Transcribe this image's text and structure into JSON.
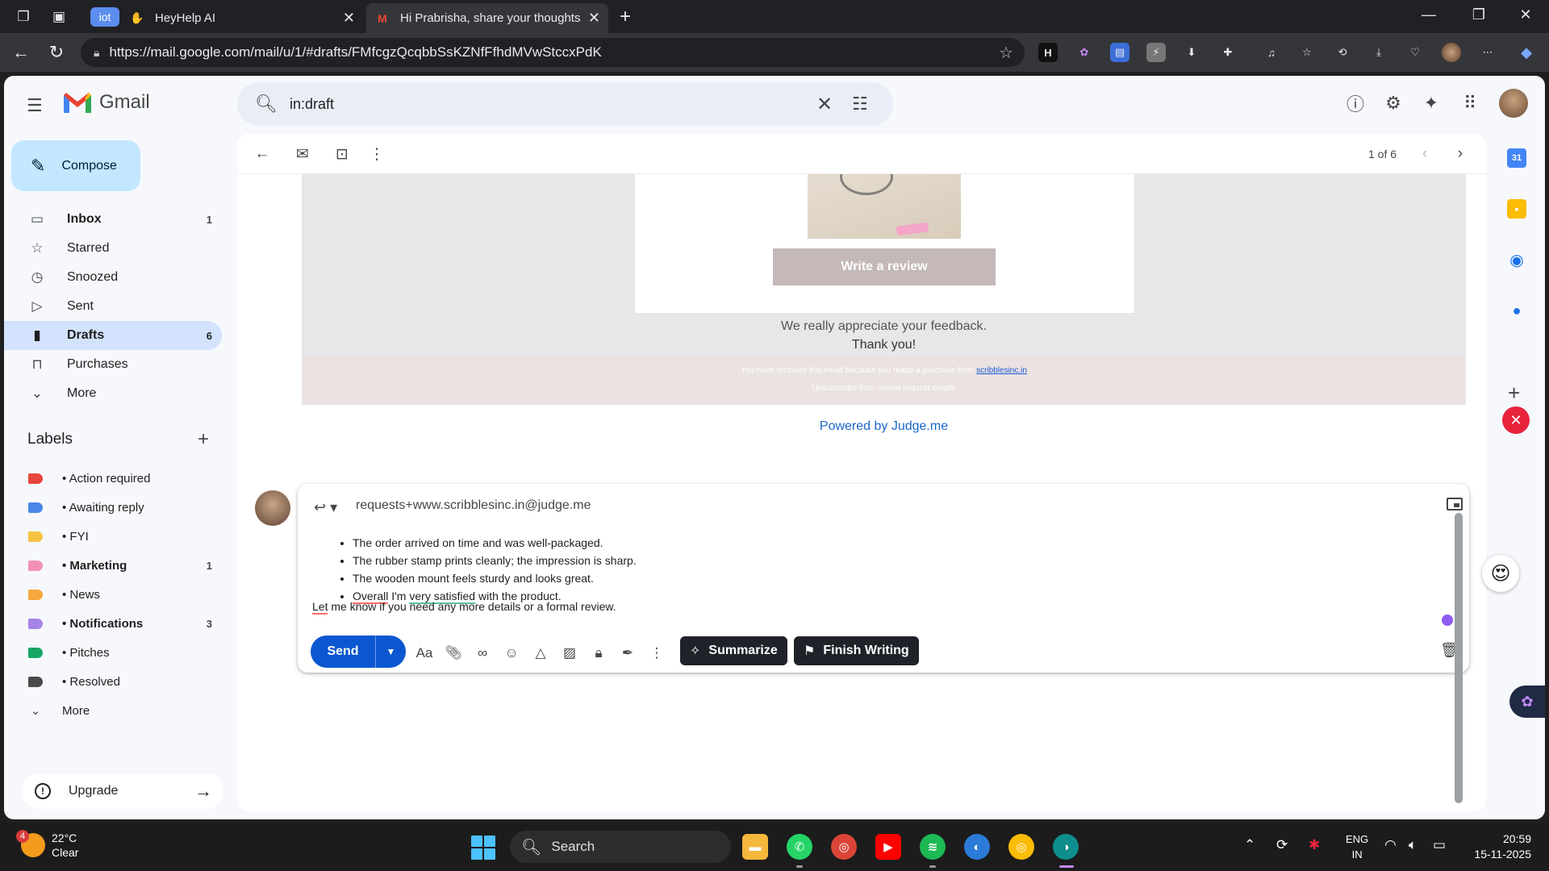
{
  "browser": {
    "tabs": [
      {
        "badge": "iot",
        "title": "HeyHelp AI"
      },
      {
        "title": "Hi Prabrisha, share your thoughts"
      }
    ],
    "url": "https://mail.google.com/mail/u/1/#drafts/FMfcgzQcqbbSsKZNfFfhdMVwStccxPdK"
  },
  "gmail": {
    "logo_text": "Gmail",
    "search_value": "in:draft",
    "compose_label": "Compose",
    "nav": [
      {
        "label": "Inbox",
        "count": "1",
        "icon": "inbox-icon"
      },
      {
        "label": "Starred",
        "count": "",
        "icon": "star-icon"
      },
      {
        "label": "Snoozed",
        "count": "",
        "icon": "clock-icon"
      },
      {
        "label": "Sent",
        "count": "",
        "icon": "send-icon"
      },
      {
        "label": "Drafts",
        "count": "6",
        "icon": "draft-icon"
      },
      {
        "label": "Purchases",
        "count": "",
        "icon": "bag-icon"
      },
      {
        "label": "More",
        "count": "",
        "icon": "chevron-down-icon"
      }
    ],
    "labels_heading": "Labels",
    "labels": [
      {
        "label": "• Action required",
        "count": "",
        "color": "#e8453c"
      },
      {
        "label": "• Awaiting reply",
        "count": "",
        "color": "#4a86e8"
      },
      {
        "label": "• FYI",
        "count": "",
        "color": "#f6c343"
      },
      {
        "label": "• Marketing",
        "count": "1",
        "color": "#f291b6"
      },
      {
        "label": "• News",
        "count": "",
        "color": "#f6a83b"
      },
      {
        "label": "• Notifications",
        "count": "3",
        "color": "#a585e8"
      },
      {
        "label": "• Pitches",
        "count": "",
        "color": "#16a765"
      },
      {
        "label": "• Resolved",
        "count": "",
        "color": "#4a4a4a"
      },
      {
        "label": "More",
        "count": "",
        "color": ""
      }
    ],
    "upgrade_label": "Upgrade",
    "pager": "1 of 6"
  },
  "email": {
    "review_button": "Write a review",
    "appreciate": "We really appreciate your feedback.",
    "thanks": "Thank you!",
    "footer_text": "You have received this email because you made a purchase from",
    "footer_link": "scribblesinc.in",
    "unsubscribe": "Unsubscribe from review request emails",
    "powered_by": "Powered by Judge.me"
  },
  "reply": {
    "recipient": "requests+www.scribblesinc.in@judge.me",
    "bullets": [
      "The order arrived on time and was well-packaged.",
      "The rubber stamp prints cleanly; the impression is sharp.",
      "The wooden mount feels sturdy and looks great."
    ],
    "bullet4_a": "Overall",
    "bullet4_b": " I'm ",
    "bullet4_c": "very satisfied",
    "bullet4_d": " with the product.",
    "closing_a": "Let",
    "closing_b": " me know if you need any more details or a formal review.",
    "send_label": "Send",
    "summarize_label": "Summarize",
    "finish_label": "Finish Writing"
  },
  "taskbar": {
    "temp": "22°C",
    "weather": "Clear",
    "weather_badge": "4",
    "search_label": "Search",
    "lang_1": "ENG",
    "lang_2": "IN",
    "time": "20:59",
    "date": "15-11-2025"
  }
}
